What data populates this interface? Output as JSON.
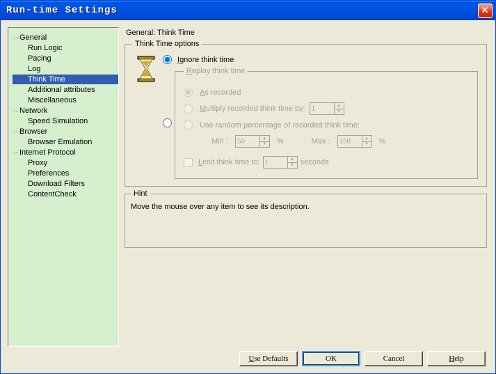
{
  "window": {
    "title": "Run-time Settings"
  },
  "tree": {
    "categories": [
      {
        "label": "General",
        "items": [
          "Run Logic",
          "Pacing",
          "Log",
          "Think Time",
          "Additional attributes",
          "Miscellaneous"
        ],
        "selected": "Think Time"
      },
      {
        "label": "Network",
        "items": [
          "Speed Simulation"
        ]
      },
      {
        "label": "Browser",
        "items": [
          "Browser Emulation"
        ]
      },
      {
        "label": "Internet Protocol",
        "items": [
          "Proxy",
          "Preferences",
          "Download Filters",
          "ContentCheck"
        ]
      }
    ]
  },
  "panel": {
    "title": "General: Think Time",
    "options_legend": "Think Time options",
    "ignore_label_pre": "I",
    "ignore_label_post": "gnore think time",
    "replay_label_pre": "R",
    "replay_label_post": "eplay think time",
    "as_recorded_pre": "A",
    "as_recorded_post": "s recorded",
    "multiply_label": "Multiply recorded think time by:",
    "multiply_accel": "M",
    "multiply_value": "1",
    "random_label": "Use random percentage of recorded think time:",
    "min_label": "Min :",
    "max_label": "Max :",
    "min_value": "50",
    "max_value": "150",
    "percent": "%",
    "limit_label": "Limit think time to:",
    "limit_accel": "L",
    "limit_value": "1",
    "seconds_label": "seconds",
    "hint_legend": "Hint",
    "hint_text": "Move the mouse over any item to see its description."
  },
  "buttons": {
    "use_defaults_pre": "U",
    "use_defaults_post": "se Defaults",
    "ok": "OK",
    "cancel": "Cancel",
    "help_pre": "H",
    "help_post": "elp"
  }
}
